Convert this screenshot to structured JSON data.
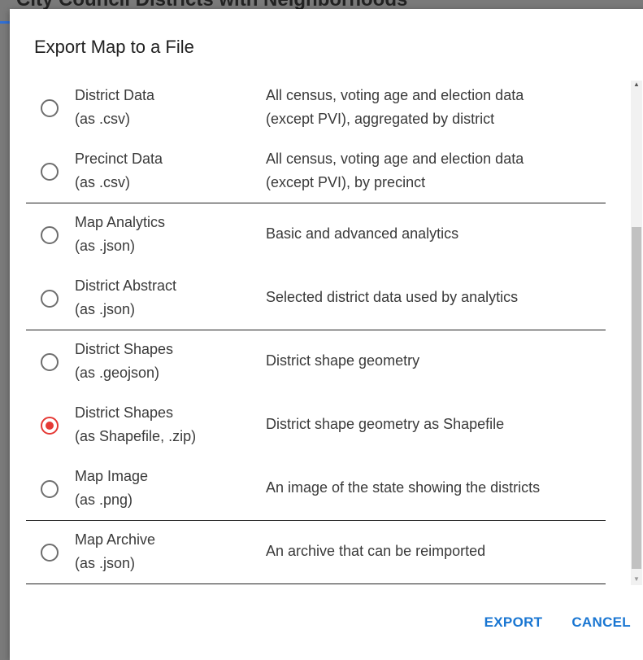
{
  "background": {
    "title": "City Council Districts with Neighborhoods"
  },
  "dialog": {
    "title": "Export Map to a File",
    "options": [
      {
        "name": "District Data",
        "format": "(as .csv)",
        "desc1": "All census, voting age and election data",
        "desc2": "(except PVI), aggregated by district",
        "selected": false
      },
      {
        "name": "Precinct Data",
        "format": "(as .csv)",
        "desc1": "All census, voting age and election data",
        "desc2": "(except PVI), by precinct",
        "selected": false
      },
      {
        "name": "Map Analytics",
        "format": "(as .json)",
        "desc1": "Basic and advanced analytics",
        "selected": false
      },
      {
        "name": "District Abstract",
        "format": "(as .json)",
        "desc1": "Selected district data used by analytics",
        "selected": false
      },
      {
        "name": "District Shapes",
        "format": "(as .geojson)",
        "desc1": "District shape geometry",
        "selected": false
      },
      {
        "name": "District Shapes",
        "format": "(as Shapefile, .zip)",
        "desc1": "District shape geometry as Shapefile",
        "selected": true
      },
      {
        "name": "Map Image",
        "format": "(as .png)",
        "desc1": "An image of the state showing the districts",
        "selected": false
      },
      {
        "name": "Map Archive",
        "format": "(as .json)",
        "desc1": "An archive that can be reimported",
        "selected": false
      }
    ],
    "export_label": "EXPORT",
    "cancel_label": "CANCEL"
  },
  "colors": {
    "accent": "#1976d2",
    "selected_radio": "#e53935"
  }
}
